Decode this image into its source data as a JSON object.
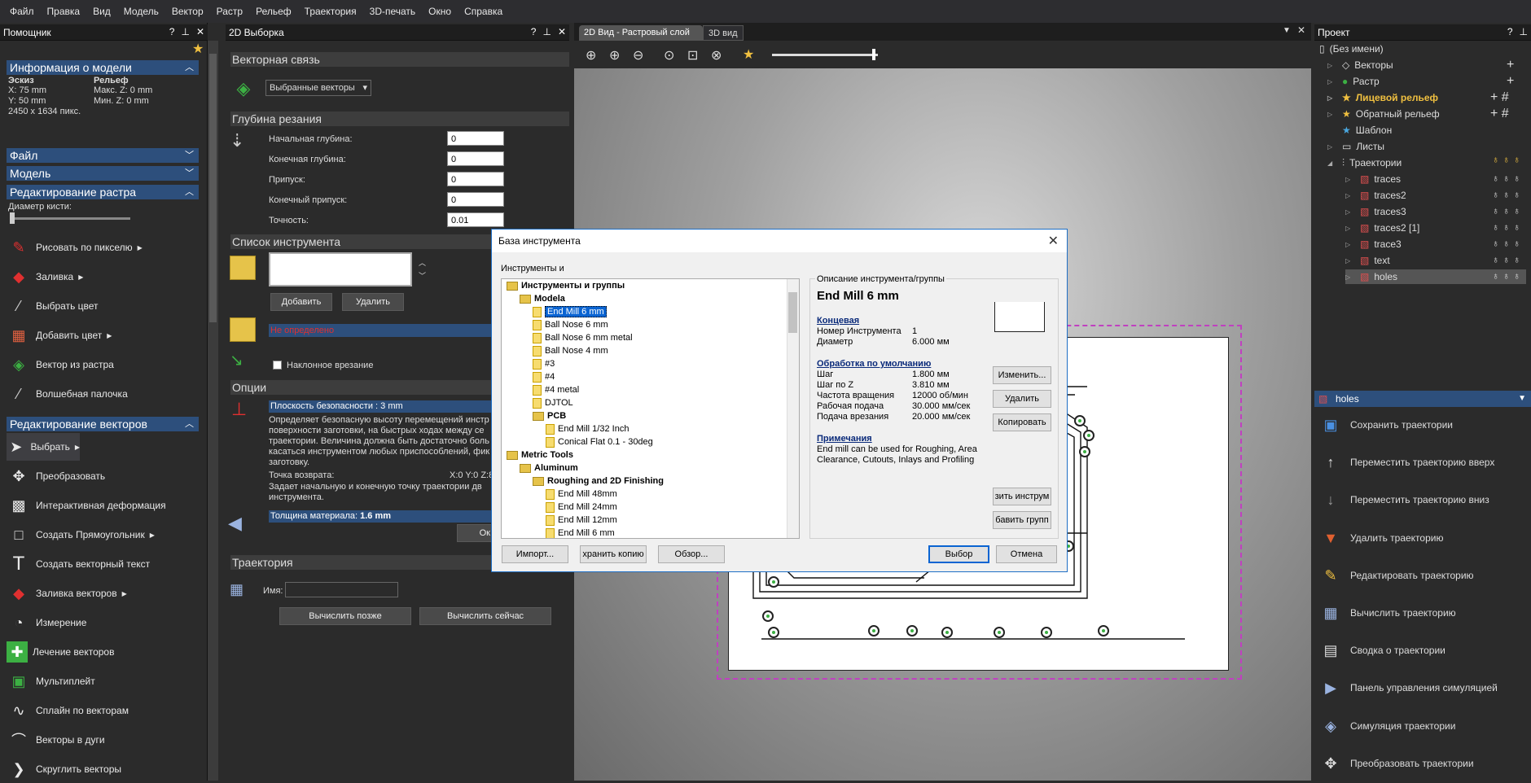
{
  "menu": [
    "Файл",
    "Правка",
    "Вид",
    "Модель",
    "Вектор",
    "Растр",
    "Рельеф",
    "Траектория",
    "3D-печать",
    "Окно",
    "Справка"
  ],
  "helper": {
    "title": "Помощник",
    "info_head": "Информация о модели",
    "sketch_label": "Эскиз",
    "sketch_x": "X: 75 mm",
    "sketch_y": "Y: 50 mm",
    "sketch_px": "2450 x 1634 пикс.",
    "relief_label": "Рельеф",
    "relief_max": "Макс. Z: 0 mm",
    "relief_min": "Мин. Z: 0 mm",
    "file_head": "Файл",
    "model_head": "Модель",
    "raster_head": "Редактирование растра",
    "brush_label": "Диаметр кисти:",
    "raster_tools": [
      "Рисовать по пикселю",
      "Заливка",
      "Выбрать цвет",
      "Добавить цвет",
      "Вектор из растра",
      "Волшебная палочка"
    ],
    "vector_head": "Редактирование векторов",
    "vector_tools": [
      "Выбрать",
      "Преобразовать",
      "Интерактивная деформация",
      "Создать Прямоугольник",
      "Создать векторный текст",
      "Заливка векторов",
      "Измерение",
      "Лечение векторов",
      "Мультиплейт",
      "Сплайн по векторам",
      "Векторы в дуги",
      "Скруглить векторы"
    ]
  },
  "vsel": {
    "title": "2D Выборка",
    "vector_link": "Векторная связь",
    "vector_select": "Выбранные векторы",
    "depth_head": "Глубина резания",
    "start_depth": "Начальная глубина:",
    "start_val": "0",
    "end_depth": "Конечная глубина:",
    "end_val": "0",
    "allowance": "Припуск:",
    "allow_val": "0",
    "end_allow": "Конечный припуск:",
    "end_allow_val": "0",
    "precision": "Точность:",
    "prec_val": "0.01",
    "tool_list": "Список инструмента",
    "add": "Добавить",
    "del": "Удалить",
    "undefined": "Не определено",
    "ramp": "Наклонное врезание",
    "options": "Опции",
    "safe_plane": "Плоскость безопасности : 3 mm",
    "safe_desc": "Определяет безопасную высоту перемещений инстр поверхности заготовки, на быстрых ходах между се траектории. Величина должна быть достаточно боль касаться инструментом любых приспособлений, фик заготовку.",
    "return_point": "Точка возврата:",
    "return_val": "X:0 Y:0 Z:8",
    "return_desc": "Задает начальную и конечную точку траектории дв инструмента.",
    "thickness": "Толщина материала: ",
    "thickness_val": "1.6 mm",
    "ok_partial": "Ок",
    "path_head": "Траектория",
    "name_label": "Имя:",
    "calc_later": "Вычислить позже",
    "calc_now": "Вычислить сейчас"
  },
  "view": {
    "tab_2d": "2D Вид - Растровый слой",
    "tab_3d": "3D вид"
  },
  "project": {
    "title": "Проект",
    "items": [
      "(Без имени)",
      "Векторы",
      "Растр",
      "Лицевой рельеф",
      "Обратный рельеф",
      "Шаблон",
      "Листы",
      "Траектории",
      "traces",
      "traces2",
      "traces3",
      "traces2 [1]",
      "trace3",
      "text",
      "holes"
    ]
  },
  "holes": {
    "title": "holes",
    "items": [
      "Сохранить траектории",
      "Переместить траекторию вверх",
      "Переместить траекторию вниз",
      "Удалить траекторию",
      "Редактировать траекторию",
      "Вычислить траекторию",
      "Сводка о траектории",
      "Панель управления симуляцией",
      "Симуляция траектории",
      "Преобразовать траектории"
    ]
  },
  "dialog": {
    "title": "База инструмента",
    "tools_label": "Инструменты и",
    "tree": [
      "Инструменты и группы",
      "Modela",
      "End Mill 6 mm",
      "Ball Nose 6 mm",
      "Ball Nose 6 mm metal",
      "Ball Nose 4 mm",
      "#3",
      "#4",
      "#4 metal",
      "DJTOL",
      "PCB",
      "End Mill 1/32 Inch",
      "Conical Flat 0.1 - 30deg",
      "Metric Tools",
      "Aluminum",
      "Roughing and 2D Finishing",
      "End Mill 48mm",
      "End Mill 24mm",
      "End Mill 12mm",
      "End Mill 6 mm"
    ],
    "desc_label": "Описание инструмента/группы",
    "tool_name": "End Mill 6 mm",
    "type": "Концевая",
    "num_label": "Номер Инструмента",
    "num_val": "1",
    "diam_label": "Диаметр",
    "diam_val": "6.000 мм",
    "defaults": "Обработка по умолчанию",
    "step_label": "Шаг",
    "step_val": "1.800 мм",
    "stepz_label": "Шаг по Z",
    "stepz_val": "3.810 мм",
    "rpm_label": "Частота вращения",
    "rpm_val": "12000 об/мин",
    "feed_label": "Рабочая подача",
    "feed_val": "30.000 мм/сек",
    "plunge_label": "Подача врезания",
    "plunge_val": "20.000 мм/сек",
    "notes": "Примечания",
    "notes_text": "End mill can be used for Roughing, Area Clearance, Cutouts, Inlays and Profiling",
    "edit": "Изменить...",
    "delete": "Удалить",
    "copy": "Копировать",
    "add_tool": "зить инструм",
    "add_group": "бавить групп",
    "import": "Импорт...",
    "save_copy": "хранить копию",
    "browse": "Обзор...",
    "select": "Выбор",
    "cancel": "Отмена"
  }
}
